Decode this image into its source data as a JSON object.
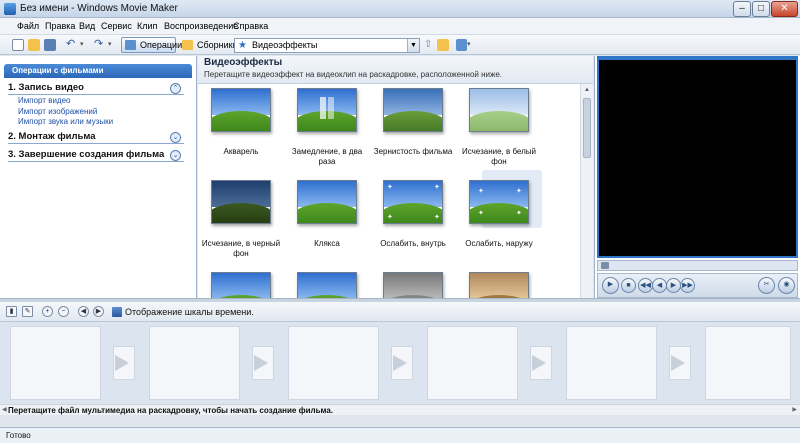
{
  "window": {
    "title": "Без имени - Windows Movie Maker",
    "min": "–",
    "max": "□",
    "close": "✕"
  },
  "menu": [
    "Файл",
    "Правка",
    "Вид",
    "Сервис",
    "Клип",
    "Воспроизведение",
    "Справка"
  ],
  "toolbar": {
    "operations_label": "Операции",
    "collections_label": "Сборники",
    "collection_selected": "Видеоэффекты"
  },
  "tasks": {
    "header": "Операции с фильмами",
    "sections": [
      {
        "label": "1. Запись видео",
        "chevron": "⌃",
        "links": [
          "Импорт видео",
          "Импорт изображений",
          "Импорт звука или музыки"
        ]
      },
      {
        "label": "2. Монтаж фильма",
        "chevron": "⌄",
        "links": []
      },
      {
        "label": "3. Завершение создания фильма",
        "chevron": "⌄",
        "links": []
      }
    ]
  },
  "effects": {
    "title": "Видеоэффекты",
    "subtitle": "Перетащите видеоэффект на видеоклип на раскадровке, расположенной ниже.",
    "items": [
      {
        "label": "Акварель"
      },
      {
        "label": "Замедление, в два раза"
      },
      {
        "label": "Зернистость фильма"
      },
      {
        "label": "Исчезание, в белый фон"
      },
      {
        "label": "Исчезание, в черный фон"
      },
      {
        "label": "Клякса"
      },
      {
        "label": "Ослабить, внутрь"
      },
      {
        "label": "Ослабить, наружу"
      },
      {
        "label": ""
      },
      {
        "label": ""
      },
      {
        "label": ""
      },
      {
        "label": ""
      }
    ]
  },
  "storyboard": {
    "timeline_toggle_label": "Отображение шкалы времени.",
    "hint": "Перетащите файл мультимедиа на раскадровку, чтобы начать создание фильма."
  },
  "status": {
    "text": "Готово"
  },
  "colors": {
    "accent": "#2f75c8",
    "link": "#1f4fa8"
  }
}
